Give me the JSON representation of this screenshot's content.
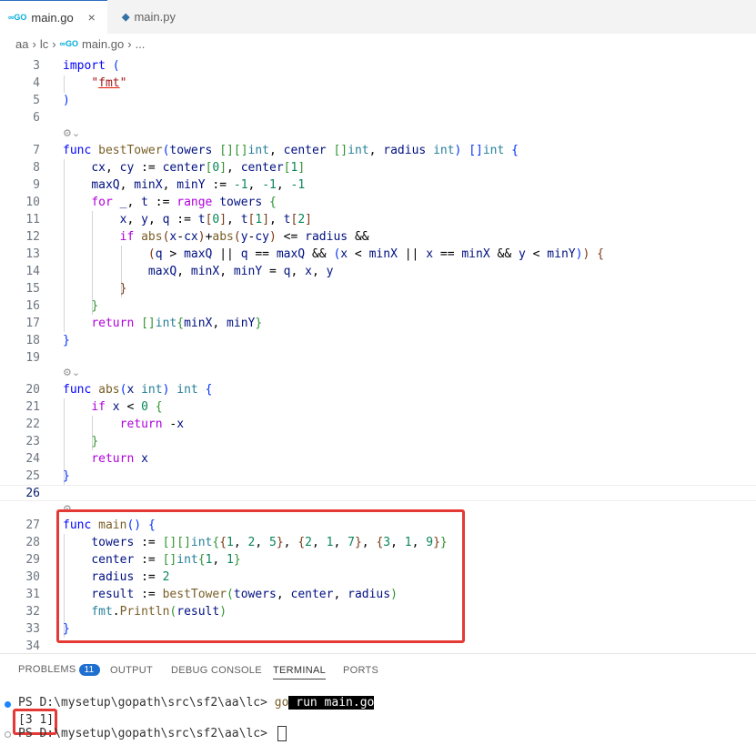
{
  "tabs": [
    {
      "label": "main.go",
      "icon": "go-icon",
      "active": true
    },
    {
      "label": "main.py",
      "icon": "python-icon",
      "active": false
    }
  ],
  "breadcrumb": {
    "seg1": "aa",
    "seg2": "lc",
    "file": "main.go",
    "more": "..."
  },
  "editor": {
    "line_numbers": [
      "3",
      "4",
      "5",
      "6",
      "7",
      "8",
      "9",
      "10",
      "11",
      "12",
      "13",
      "14",
      "15",
      "16",
      "17",
      "18",
      "19",
      "20",
      "21",
      "22",
      "23",
      "24",
      "25",
      "26",
      "27",
      "28",
      "29",
      "30",
      "31",
      "32",
      "33",
      "34"
    ]
  },
  "panel": {
    "tabs": {
      "problems": "PROBLEMS",
      "problems_count": "11",
      "output": "OUTPUT",
      "debug": "DEBUG CONSOLE",
      "terminal": "TERMINAL",
      "ports": "PORTS"
    },
    "terminal": {
      "prompt1": "PS D:\\mysetup\\gopath\\src\\sf2\\aa\\lc> ",
      "cmd_go": "go",
      "cmd_rest": " run main.go",
      "output": "[3 1]",
      "prompt2": "PS D:\\mysetup\\gopath\\src\\sf2\\aa\\lc> "
    }
  },
  "colors": {
    "accent": "#1f6fd1",
    "highlight_box": "#e53935"
  }
}
